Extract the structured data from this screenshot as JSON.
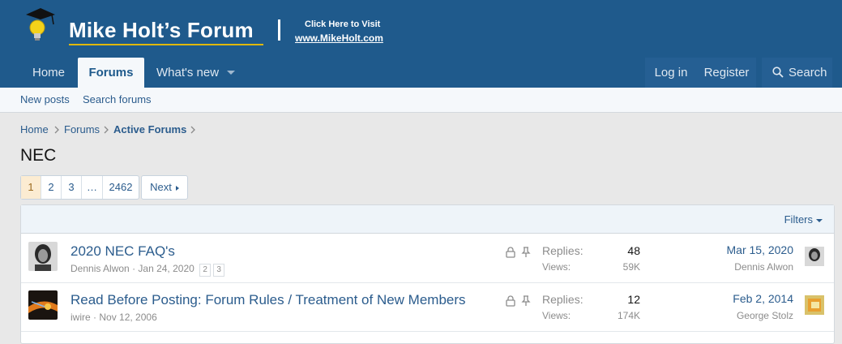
{
  "header": {
    "site_title": "Mike Holt’s Forum",
    "visit_line1": "Click Here to Visit",
    "visit_line2": "www.MikeHolt.com"
  },
  "nav": {
    "home": "Home",
    "forums": "Forums",
    "whats_new": "What's new",
    "login": "Log in",
    "register": "Register",
    "search": "Search"
  },
  "subnav": {
    "new_posts": "New posts",
    "search_forums": "Search forums"
  },
  "breadcrumb": {
    "home": "Home",
    "forums": "Forums",
    "active": "Active Forums"
  },
  "page_title": "NEC",
  "pagination": {
    "pages": [
      "1",
      "2",
      "3",
      "…",
      "2462"
    ],
    "next": "Next",
    "current": "1"
  },
  "filters_label": "Filters",
  "threads": [
    {
      "title": "2020 NEC FAQ's",
      "author": "Dennis Alwon",
      "date": "Jan 24, 2020",
      "mini_pages": [
        "2",
        "3"
      ],
      "replies_label": "Replies:",
      "replies": "48",
      "views_label": "Views:",
      "views": "59K",
      "last_date": "Mar 15, 2020",
      "last_user": "Dennis Alwon"
    },
    {
      "title": "Read Before Posting: Forum Rules / Treatment of New Members",
      "author": "iwire",
      "date": "Nov 12, 2006",
      "replies_label": "Replies:",
      "replies": "12",
      "views_label": "Views:",
      "views": "174K",
      "last_date": "Feb 2, 2014",
      "last_user": "George Stolz"
    }
  ],
  "meta_separator": "·",
  "colors": {
    "header_bg": "#1f5a8c",
    "link": "#2b5c8d",
    "accent_underline": "#e0b80c"
  }
}
